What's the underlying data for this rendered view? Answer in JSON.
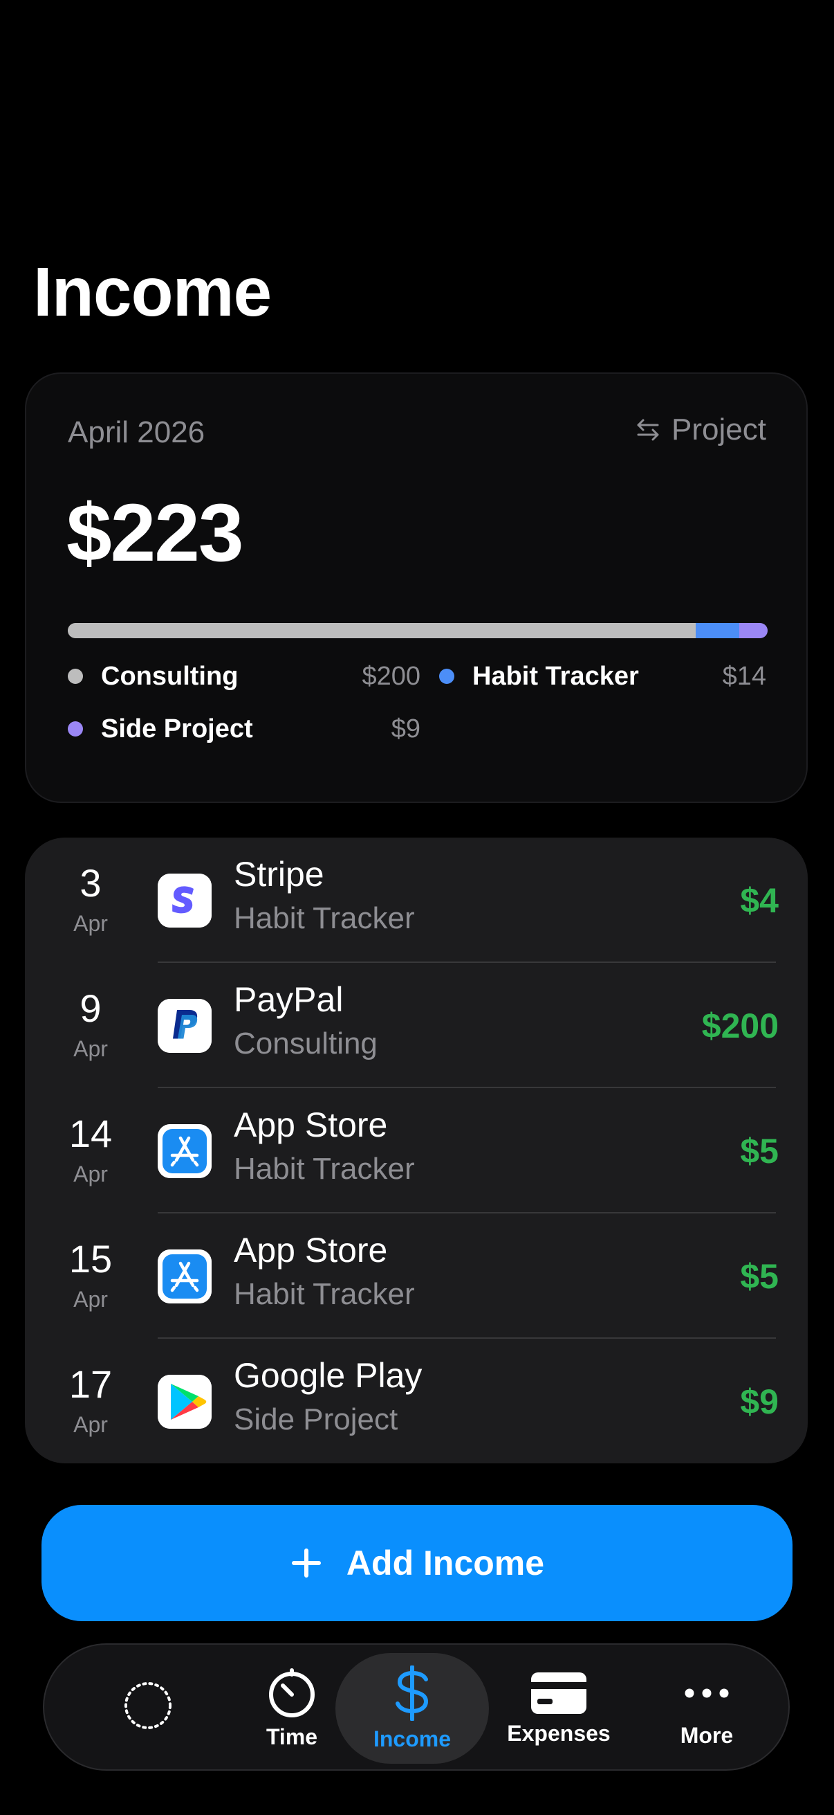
{
  "header": {
    "title": "Income"
  },
  "summary": {
    "month": "April 2026",
    "group_by": "Project",
    "total": "$223",
    "breakdown": [
      {
        "name": "Consulting",
        "value": "$200",
        "amount": 200,
        "color": "#bdbdbd"
      },
      {
        "name": "Habit Tracker",
        "value": "$14",
        "amount": 14,
        "color": "#4c8ef7"
      },
      {
        "name": "Side Project",
        "value": "$9",
        "amount": 9,
        "color": "#9b87f5"
      }
    ]
  },
  "transactions": [
    {
      "day": "3",
      "month": "Apr",
      "source": "Stripe",
      "project": "Habit Tracker",
      "amount": "$4",
      "icon": "stripe-icon"
    },
    {
      "day": "9",
      "month": "Apr",
      "source": "PayPal",
      "project": "Consulting",
      "amount": "$200",
      "icon": "paypal-icon"
    },
    {
      "day": "14",
      "month": "Apr",
      "source": "App Store",
      "project": "Habit Tracker",
      "amount": "$5",
      "icon": "app-store-icon"
    },
    {
      "day": "15",
      "month": "Apr",
      "source": "App Store",
      "project": "Habit Tracker",
      "amount": "$5",
      "icon": "app-store-icon"
    },
    {
      "day": "17",
      "month": "Apr",
      "source": "Google Play",
      "project": "Side Project",
      "amount": "$9",
      "icon": "google-play-icon"
    }
  ],
  "actions": {
    "add_income": "Add Income"
  },
  "tabs": [
    {
      "label": "",
      "icon": "dotted-circle-icon"
    },
    {
      "label": "Time",
      "icon": "timer-icon"
    },
    {
      "label": "Income",
      "icon": "dollar-icon",
      "active": true
    },
    {
      "label": "Expenses",
      "icon": "card-icon"
    },
    {
      "label": "More",
      "icon": "ellipsis-icon"
    }
  ],
  "colors": {
    "accent": "#0a8ffd",
    "positive": "#30b552",
    "active_tab": "#1e9bff"
  }
}
